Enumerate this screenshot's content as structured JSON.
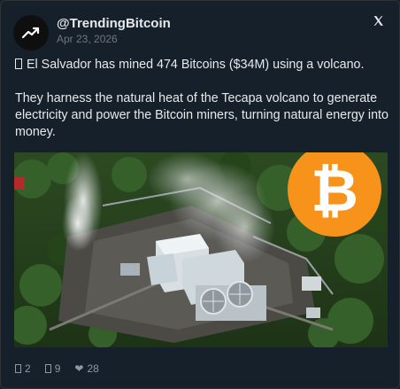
{
  "author": {
    "handle": "@TrendingBitcoin",
    "date": "Apr 23, 2026"
  },
  "tweet": {
    "line1": "El Salvador has mined 474 Bitcoins ($34M) using a volcano.",
    "line2": "They harness the natural heat of the Tecapa volcano to generate",
    "line3": "electricity and power the Bitcoin miners, turning natural energy into",
    "line4": "money."
  },
  "media": {
    "bitcoin_symbol": "₿"
  },
  "stats": {
    "replies": "2",
    "retweets": "9",
    "likes": "28"
  },
  "colors": {
    "background": "#15202b",
    "text": "#e7e9ea",
    "muted": "#71767b",
    "bitcoin_orange": "#f7931a"
  },
  "icons": {
    "avatar": "trending-up-icon",
    "platform": "x-logo-icon",
    "reply": "reply-icon",
    "retweet": "retweet-icon",
    "like": "heart-icon"
  }
}
